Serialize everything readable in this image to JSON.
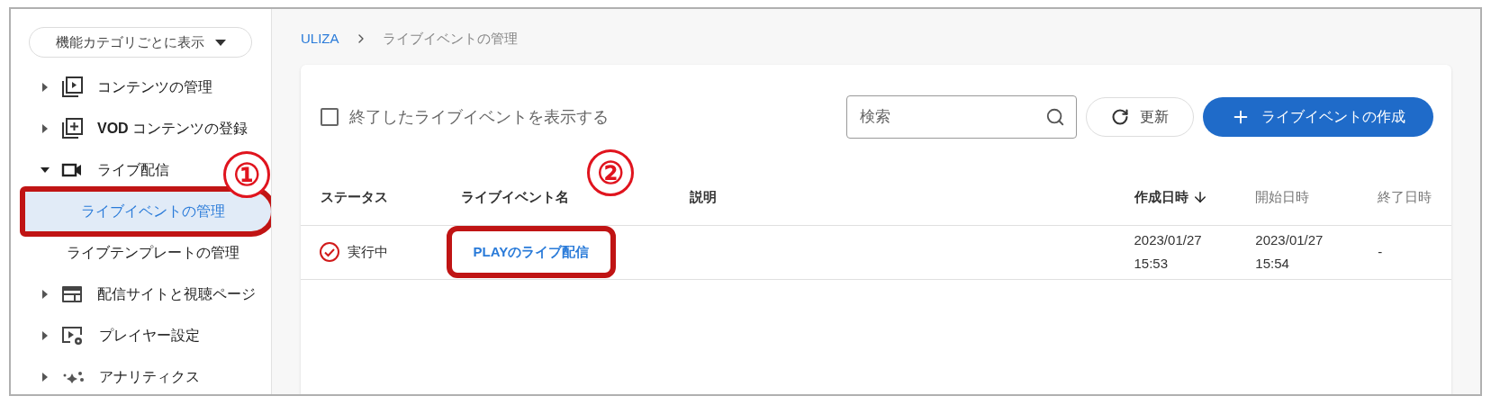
{
  "sidebar": {
    "category_button": {
      "label": "機能カテゴリごとに表示"
    },
    "items": [
      {
        "label": "コンテンツの管理",
        "expanded": false
      },
      {
        "label": "コンテンツの登録",
        "expanded": false,
        "bold_prefix": "VOD"
      },
      {
        "label": "ライブ配信",
        "expanded": true,
        "children": [
          {
            "label": "ライブイベントの管理",
            "selected": true,
            "highlighted": true,
            "annotation": "①"
          },
          {
            "label": "ライブテンプレートの管理",
            "selected": false,
            "highlighted": false
          }
        ]
      },
      {
        "label": "配信サイトと視聴ページ",
        "expanded": false
      },
      {
        "label": "プレイヤー設定",
        "expanded": false
      },
      {
        "label": "アナリティクス",
        "expanded": false
      }
    ]
  },
  "breadcrumb": [
    {
      "label": "ULIZA",
      "link": true
    },
    {
      "label": "ライブイベントの管理",
      "link": false
    }
  ],
  "toolbar": {
    "show_ended": {
      "label": "終了したライブイベントを表示する",
      "checked": false
    },
    "search": {
      "placeholder": "検索"
    },
    "refresh_button": {
      "label": "更新"
    },
    "create_button": {
      "label": "ライブイベントの作成"
    }
  },
  "table": {
    "columns": [
      {
        "label": "ステータス",
        "sorted": false,
        "dimmed": false
      },
      {
        "label": "ライブイベント名",
        "sorted": false,
        "dimmed": false,
        "annotation": "②"
      },
      {
        "label": "説明",
        "sorted": false,
        "dimmed": false
      },
      {
        "label": "作成日時",
        "sorted": true,
        "dimmed": false
      },
      {
        "label": "開始日時",
        "sorted": false,
        "dimmed": true
      },
      {
        "label": "終了日時",
        "sorted": false,
        "dimmed": true
      }
    ],
    "rows": [
      {
        "status": {
          "kind": "running",
          "label": "実行中"
        },
        "name": "PLAYのライブ配信",
        "name_highlighted": true,
        "created": [
          "2023/01/27",
          "15:53"
        ],
        "started": [
          "2023/01/27",
          "15:54"
        ],
        "ended": "-"
      }
    ]
  }
}
